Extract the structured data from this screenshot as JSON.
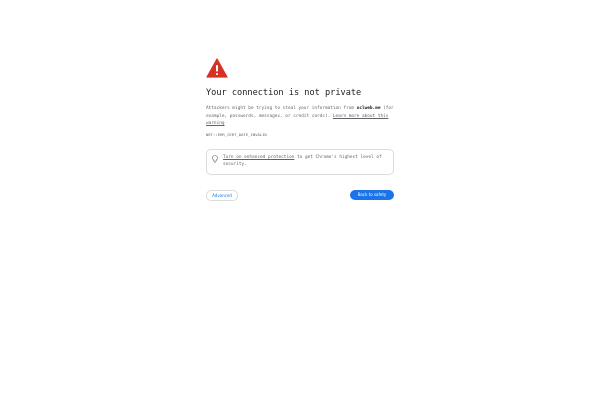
{
  "interstitial": {
    "title": "Your connection is not private",
    "desc_pre": "Attackers might be trying to steal your information from ",
    "domain": "oclweb.me",
    "desc_post": " (for example, passwords, messages, or credit cards). ",
    "learn_more": "Learn more about this warning",
    "error_code": "NET::ERR_CERT_DATE_INVALID",
    "protection_link": "Turn on enhanced protection",
    "protection_text": " to get Chrome's highest level of security.",
    "advanced_label": "Advanced",
    "back_label": "Back to safety"
  },
  "colors": {
    "warning_red": "#d93025",
    "primary_blue": "#1a73e8",
    "text_primary": "#202124",
    "text_secondary": "#5f6368",
    "border": "#dadce0"
  },
  "icons": {
    "warning": "warning-triangle-icon",
    "protection": "lightbulb-icon"
  }
}
